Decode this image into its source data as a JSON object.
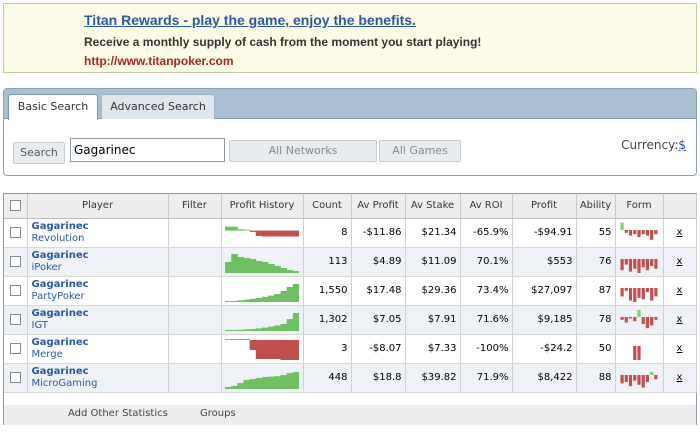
{
  "ad": {
    "title": "Titan Rewards - play the game, enjoy the benefits.",
    "description": "Receive a monthly supply of cash from the moment you start playing!",
    "url": "http://www.titanpoker.com"
  },
  "search": {
    "tabs": [
      "Basic Search",
      "Advanced Search"
    ],
    "active_tab": "Basic Search",
    "search_button": "Search",
    "query": "Gagarinec",
    "network_select": "All Networks",
    "games_select": "All Games",
    "currency_label": "Currency:",
    "currency_value": "$"
  },
  "table": {
    "columns": [
      "Player",
      "Filter",
      "Profit History",
      "Count",
      "Av Profit",
      "Av Stake",
      "Av ROI",
      "Profit",
      "Ability",
      "Form"
    ],
    "rows": [
      {
        "name": "Gagarinec",
        "network": "Revolution",
        "count": "8",
        "av_profit": "-$11.86",
        "av_stake": "$21.34",
        "av_roi": "-65.9%",
        "profit": "-$94.91",
        "ability": "55",
        "remove": "x",
        "history": [
          0.3,
          0.3,
          0.1,
          0.0,
          -0.1,
          -0.4,
          -0.45,
          -0.45,
          -0.45,
          -0.45,
          -0.45,
          -0.45
        ],
        "form": [
          0.9,
          -0.2,
          -0.4,
          -0.3,
          -0.5,
          -0.3,
          -0.4,
          -0.7,
          -0.3
        ]
      },
      {
        "name": "Gagarinec",
        "network": "iPoker",
        "count": "113",
        "av_profit": "$4.89",
        "av_stake": "$11.09",
        "av_roi": "70.1%",
        "profit": "$553",
        "ability": "76",
        "remove": "x",
        "history": [
          0.55,
          0.95,
          0.8,
          0.75,
          0.7,
          0.6,
          0.55,
          0.45,
          0.35,
          0.25,
          0.15,
          0.1
        ],
        "form": [
          -0.8,
          -0.4,
          -0.9,
          -0.7,
          -1.0,
          -0.6,
          -0.8,
          -0.5,
          -0.7
        ]
      },
      {
        "name": "Gagarinec",
        "network": "PartyPoker",
        "count": "1,550",
        "av_profit": "$17.48",
        "av_stake": "$29.36",
        "av_roi": "73.4%",
        "profit": "$27,097",
        "ability": "87",
        "remove": "x",
        "history": [
          0.02,
          0.05,
          0.08,
          0.12,
          0.16,
          0.2,
          0.26,
          0.32,
          0.4,
          0.55,
          0.75,
          0.9
        ],
        "form": [
          -0.6,
          -0.2,
          -0.9,
          -1.0,
          -0.7,
          -0.8,
          -0.3,
          -0.9,
          -0.6
        ]
      },
      {
        "name": "Gagarinec",
        "network": "IGT",
        "count": "1,302",
        "av_profit": "$7.05",
        "av_stake": "$7.91",
        "av_roi": "71.6%",
        "profit": "$9,185",
        "ability": "78",
        "remove": "x",
        "history": [
          0.02,
          0.04,
          0.06,
          0.08,
          0.1,
          0.13,
          0.17,
          0.22,
          0.28,
          0.35,
          0.6,
          0.9
        ],
        "form": [
          -0.2,
          -0.4,
          -0.1,
          -0.3,
          0.9,
          -0.5,
          -0.8,
          -0.6,
          -0.2
        ]
      },
      {
        "name": "Gagarinec",
        "network": "Merge",
        "count": "3",
        "av_profit": "-$8.07",
        "av_stake": "$7.33",
        "av_roi": "-100%",
        "profit": "-$24.2",
        "ability": "50",
        "remove": "x",
        "history": [
          0.0,
          0.0,
          0.0,
          0.0,
          -0.5,
          -0.95,
          -0.95,
          -0.95,
          -0.95,
          -1.0,
          -1.0,
          -1.0
        ],
        "form": [
          0.0,
          0.0,
          0.0,
          -1.0,
          -1.0,
          0.0,
          0.0,
          0.0,
          0.0
        ]
      },
      {
        "name": "Gagarinec",
        "network": "MicroGaming",
        "count": "448",
        "av_profit": "$18.8",
        "av_stake": "$39.82",
        "av_roi": "71.9%",
        "profit": "$8,422",
        "ability": "88",
        "remove": "x",
        "history": [
          0.1,
          0.15,
          0.3,
          0.45,
          0.5,
          0.55,
          0.6,
          0.62,
          0.64,
          0.7,
          0.8,
          0.85
        ],
        "form": [
          -0.6,
          -0.5,
          -0.8,
          -0.4,
          -0.7,
          -0.9,
          -0.5,
          0.4,
          -0.3
        ]
      }
    ],
    "footer": {
      "add_stats": "Add Other Statistics",
      "groups": "Groups"
    }
  },
  "colors": {
    "positive": "#6fbf63",
    "negative": "#c0504d",
    "link": "#2a57a6"
  }
}
